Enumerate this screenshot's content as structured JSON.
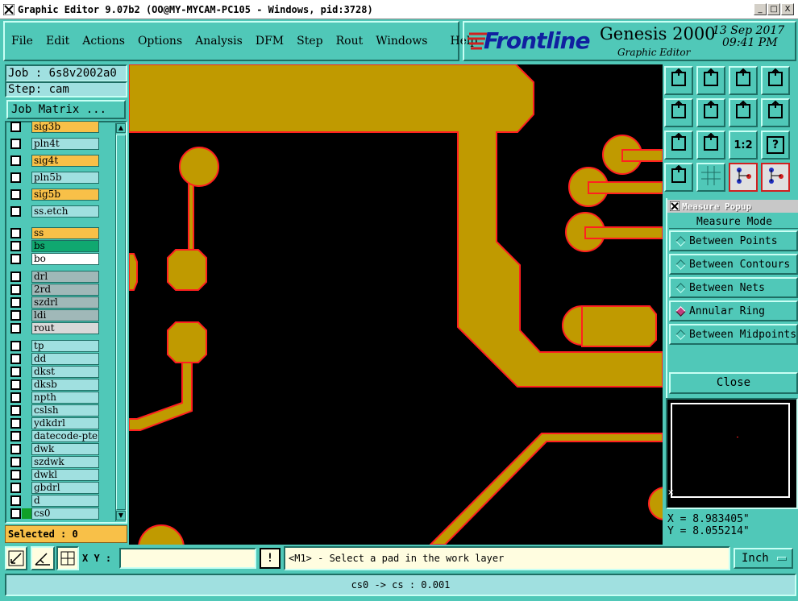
{
  "window": {
    "title": "Graphic Editor 9.07b2 (OO@MY-MYCAM-PC105 - Windows, pid:3728)",
    "minimize": "_",
    "maximize": "□",
    "close": "X"
  },
  "menu": [
    "File",
    "Edit",
    "Actions",
    "Options",
    "Analysis",
    "DFM",
    "Step",
    "Rout",
    "Windows",
    "Help"
  ],
  "brand": {
    "logo": "Frontline",
    "product": "Genesis 2000",
    "subtitle": "Graphic Editor",
    "date": "13 Sep 2017",
    "time": "09:41 PM"
  },
  "job": {
    "label": "Job : 6s8v2002a0",
    "step": "Step: cam",
    "matrix_button": "Job Matrix ..."
  },
  "layers": [
    {
      "name": "sig3b",
      "color": "#f8c048"
    },
    {
      "name": "pln4t",
      "color": "#a0e0e0"
    },
    {
      "name": "sig4t",
      "color": "#f8c048"
    },
    {
      "name": "pln5b",
      "color": "#a0e0e0"
    },
    {
      "name": "sig5b",
      "color": "#f8c048"
    },
    {
      "name": "ss.etch",
      "color": "#a0e0e0"
    },
    {
      "name": "ss",
      "color": "#f8c048"
    },
    {
      "name": "bs",
      "color": "#10a870"
    },
    {
      "name": "bo",
      "color": "#ffffff"
    },
    {
      "name": "drl",
      "color": "#a0b8b8"
    },
    {
      "name": "2rd",
      "color": "#a0b8b8"
    },
    {
      "name": "szdrl",
      "color": "#a0b8b8"
    },
    {
      "name": "ldi",
      "color": "#a0b8b8"
    },
    {
      "name": "rout",
      "color": "#d8d8d8"
    },
    {
      "name": "tp",
      "color": "#a0e0e0"
    },
    {
      "name": "dd",
      "color": "#a0e0e0"
    },
    {
      "name": "dkst",
      "color": "#a0e0e0"
    },
    {
      "name": "dksb",
      "color": "#a0e0e0"
    },
    {
      "name": "npth",
      "color": "#a0e0e0"
    },
    {
      "name": "cslsh",
      "color": "#a0e0e0"
    },
    {
      "name": "ydkdrl",
      "color": "#a0e0e0"
    },
    {
      "name": "datecode-pte",
      "color": "#a0e0e0"
    },
    {
      "name": "dwk",
      "color": "#a0e0e0"
    },
    {
      "name": "szdwk",
      "color": "#a0e0e0"
    },
    {
      "name": "dwkl",
      "color": "#a0e0e0"
    },
    {
      "name": "gbdrl",
      "color": "#a0e0e0"
    },
    {
      "name": "d",
      "color": "#a0e0e0"
    },
    {
      "name": "cs0",
      "color": "#a0e0e0"
    }
  ],
  "selected": "Selected : 0",
  "measure": {
    "title": "Measure Popup",
    "mode_label": "Measure Mode",
    "options": [
      "Between Points",
      "Between Contours",
      "Between Nets",
      "Annular Ring",
      "Between Midpoints"
    ],
    "selected_index": 3,
    "close": "Close"
  },
  "coords": {
    "x": "X = 8.983405\"",
    "y": "Y = 8.055214\""
  },
  "bottom": {
    "xy_label": "X Y :",
    "xy_value": "",
    "warn": "!",
    "prompt": "<M1> - Select a pad in the work layer",
    "units": "Inch",
    "status": "cs0 -> cs : 0.001"
  },
  "toolbar_buttons": [
    "1:2",
    "?"
  ]
}
